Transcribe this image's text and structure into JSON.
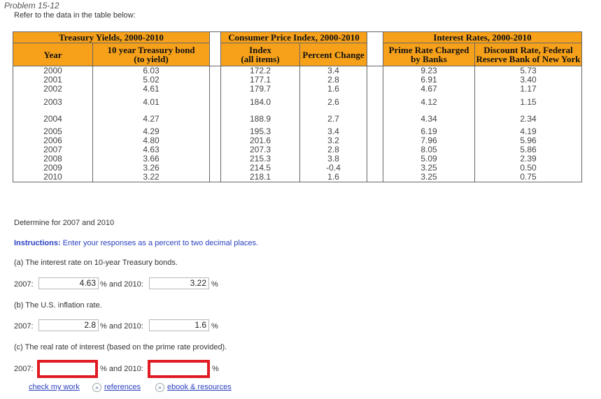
{
  "header": {
    "problem": "Problem 15-12",
    "intro": "Refer to the data in the table below:"
  },
  "table": {
    "group_headers": [
      "Treasury Yields, 2000-2010",
      "Consumer Price Index, 2000-2010",
      "Interest Rates, 2000-2010"
    ],
    "col_headers": {
      "year": "Year",
      "treasury": [
        "10 year Treasury bond",
        "(to yield)"
      ],
      "cpi_index": [
        "Index",
        "(all items)"
      ],
      "cpi_change": "Percent Change",
      "prime": [
        "Prime Rate Charged",
        "by Banks"
      ],
      "discount": [
        "Discount Rate, Federal",
        "Reserve Bank of New York"
      ]
    },
    "rows": [
      [
        "2000",
        "6.03",
        "172.2",
        "3.4",
        "9.23",
        "5.73"
      ],
      [
        "2001",
        "5.02",
        "177.1",
        "2.8",
        "6.91",
        "3.40"
      ],
      [
        "2002",
        "4.61",
        "179.7",
        "1.6",
        "4.67",
        "1.17"
      ],
      [
        "2003",
        "4.01",
        "184.0",
        "2.6",
        "4.12",
        "1.15"
      ],
      [
        "2004",
        "4.27",
        "188.9",
        "2.7",
        "4.34",
        "2.34"
      ],
      [
        "2005",
        "4.29",
        "195.3",
        "3.4",
        "6.19",
        "4.19"
      ],
      [
        "2006",
        "4.80",
        "201.6",
        "3.2",
        "7.96",
        "5.96"
      ],
      [
        "2007",
        "4.63",
        "207.3",
        "2.8",
        "8.05",
        "5.86"
      ],
      [
        "2008",
        "3.66",
        "215.3",
        "3.8",
        "5.09",
        "2.39"
      ],
      [
        "2009",
        "3.26",
        "214.5",
        "-0.4",
        "3.25",
        "0.50"
      ],
      [
        "2010",
        "3.22",
        "218.1",
        "1.6",
        "3.25",
        "0.75"
      ]
    ]
  },
  "questions": {
    "determine": "Determine for 2007 and 2010",
    "instructions_label": "Instructions:",
    "instructions_text": " Enter your responses as a percent to two decimal places.",
    "a": "(a) The interest rate on 10-year Treasury bonds.",
    "b": "(b) The U.S. inflation rate.",
    "c": "(c) The real rate of interest (based on the prime rate provided).",
    "label_2007": "2007:",
    "label_pct_and_2010": "% and 2010:",
    "label_pct": "%",
    "a_2007": "4.63",
    "a_2010": "3.22",
    "b_2007": "2.8",
    "b_2010": "1.6",
    "c_2007": "",
    "c_2010": ""
  },
  "footer": {
    "check": "check my work",
    "references": "references",
    "ebook": "ebook & resources",
    "icon_glyph": "»"
  },
  "colors": {
    "header_bg": "#f7a11a",
    "link": "#2a3fbf",
    "error_border": "#e01b24"
  }
}
